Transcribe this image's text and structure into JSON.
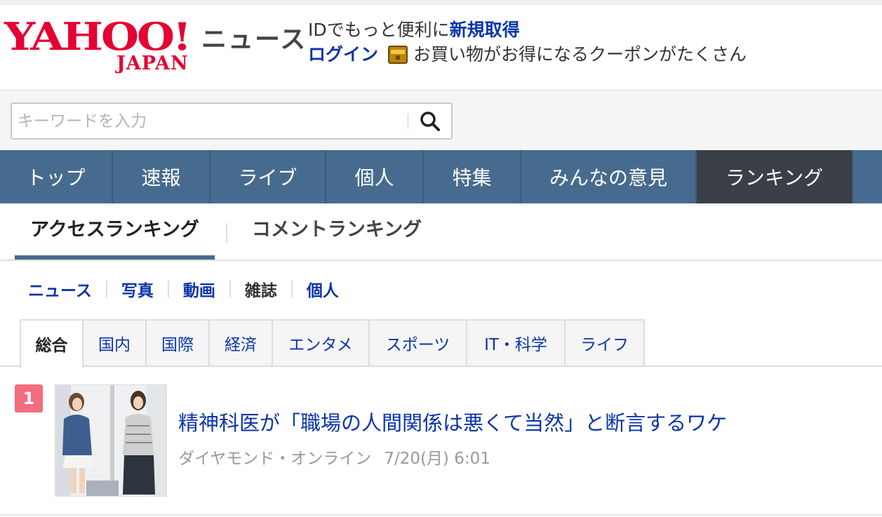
{
  "header": {
    "logo_main": "YAHOO!",
    "logo_sub": "JAPAN",
    "service_name": "ニュース",
    "promo_text": "IDでもっと便利に",
    "promo_link": "新規取得",
    "login_label": "ログイン",
    "coupon_text": "お買い物がお得になるクーポンがたくさん",
    "coupon_icon": "treasure-chest-icon"
  },
  "search": {
    "placeholder": "キーワードを入力",
    "button_icon": "search-icon"
  },
  "main_nav": {
    "items": [
      {
        "label": "トップ"
      },
      {
        "label": "速報"
      },
      {
        "label": "ライブ"
      },
      {
        "label": "個人"
      },
      {
        "label": "特集"
      },
      {
        "label": "みんなの意見"
      },
      {
        "label": "ランキング"
      }
    ],
    "active": "ランキング"
  },
  "ranking_tabs": {
    "access": "アクセスランキング",
    "comment": "コメントランキング",
    "active": "アクセスランキング"
  },
  "sub_nav": {
    "items": [
      {
        "label": "ニュース"
      },
      {
        "label": "写真"
      },
      {
        "label": "動画"
      },
      {
        "label": "雑誌"
      },
      {
        "label": "個人"
      }
    ],
    "current": "雑誌"
  },
  "category_tabs": {
    "items": [
      {
        "label": "総合"
      },
      {
        "label": "国内"
      },
      {
        "label": "国際"
      },
      {
        "label": "経済"
      },
      {
        "label": "エンタメ"
      },
      {
        "label": "スポーツ"
      },
      {
        "label": "IT・科学"
      },
      {
        "label": "ライフ"
      }
    ],
    "active": "総合"
  },
  "articles": [
    {
      "rank": "1",
      "title": "精神科医が「職場の人間関係は悪くて当然」と断言するワケ",
      "source": "ダイヤモンド・オンライン",
      "time": "7/20(月) 6:01"
    }
  ],
  "colors": {
    "brand_red": "#e60033",
    "nav_blue": "#476b8e",
    "nav_active": "#3b3f48",
    "link_blue": "#0b35a8",
    "rank_badge": "#f26d7d"
  }
}
